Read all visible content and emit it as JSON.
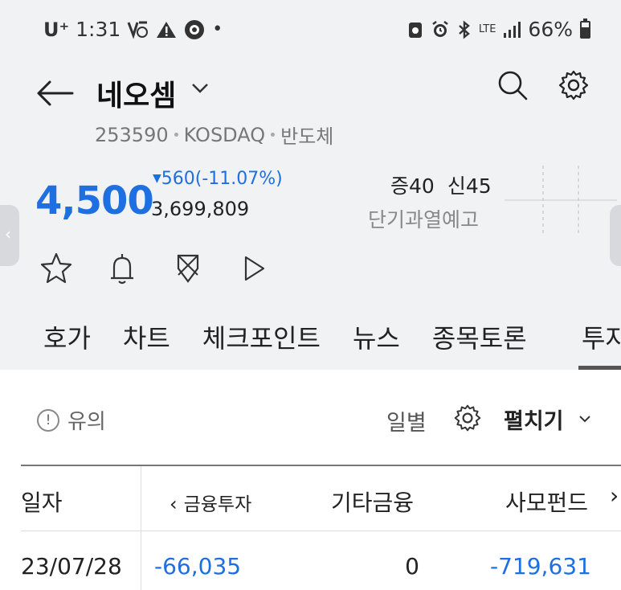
{
  "status_bar": {
    "carrier": "U⁺",
    "time": "1:31",
    "indicator_dot": "•",
    "lte_label": "LTE",
    "battery_text": "66%",
    "battery_level": 0.66,
    "icons": [
      "volte-icon",
      "warning-icon",
      "starbucks-icon",
      "screenshot-icon",
      "alarm-icon",
      "bluetooth-icon",
      "signal-icon",
      "battery-icon"
    ]
  },
  "header": {
    "stock_name": "네오셈",
    "code": "253590",
    "market": "KOSDAQ",
    "sector": "반도체"
  },
  "quote": {
    "price": "4,500",
    "change": "560(-11.07%)",
    "change_arrow": "▼",
    "volume": "3,699,809",
    "margin_rate": "증40",
    "credit_rate": "신45",
    "warning": "단기과열예고"
  },
  "tabs": [
    "호가",
    "차트",
    "체크포인트",
    "뉴스",
    "종목토론"
  ],
  "tab_partial": "투자자",
  "controls": {
    "caution_icon": "!",
    "caution_label": "유의",
    "period_label": "일별",
    "expand_label": "펼치기"
  },
  "table": {
    "headers": [
      "일자",
      "금융투자",
      "기타금융",
      "사모펀드"
    ],
    "rows": [
      [
        "23/07/28",
        "-66,035",
        "0",
        "-719,631"
      ]
    ]
  },
  "colors": {
    "down": "#1e6fe0",
    "background_top": "#f1f2f4"
  }
}
